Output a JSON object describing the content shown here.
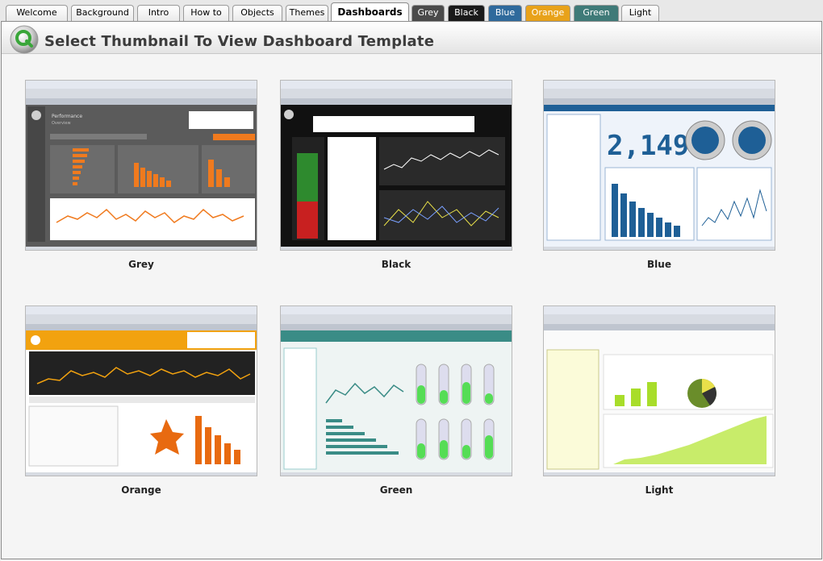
{
  "tabs": [
    {
      "label": "Welcome",
      "style": "light"
    },
    {
      "label": "Background",
      "style": "light"
    },
    {
      "label": "Intro",
      "style": "light"
    },
    {
      "label": "How to",
      "style": "light"
    },
    {
      "label": "Objects",
      "style": "light"
    },
    {
      "label": "Themes",
      "style": "light"
    },
    {
      "label": "Dashboards",
      "style": "active"
    },
    {
      "label": "Grey",
      "style": "grey",
      "color": "#4a4a4a"
    },
    {
      "label": "Black",
      "style": "dark",
      "color": "#1a1a1a"
    },
    {
      "label": "Blue",
      "style": "colored",
      "color": "#2f6a9c"
    },
    {
      "label": "Orange",
      "style": "colored",
      "color": "#e8a21a"
    },
    {
      "label": "Green",
      "style": "colored",
      "color": "#3f7a78"
    },
    {
      "label": "Light",
      "style": "light"
    }
  ],
  "page": {
    "title": "Select Thumbnail To View Dashboard Template"
  },
  "thumbnails": [
    {
      "label": "Grey",
      "theme": "grey",
      "accent": "#f07a1e"
    },
    {
      "label": "Black",
      "theme": "black",
      "accent": "#2e8a2e"
    },
    {
      "label": "Blue",
      "theme": "blue",
      "accent": "#1e5f96"
    },
    {
      "label": "Orange",
      "theme": "orange",
      "accent": "#f2a20f"
    },
    {
      "label": "Green",
      "theme": "green",
      "accent": "#3a8c86"
    },
    {
      "label": "Light",
      "theme": "light",
      "accent": "#a8dd2a"
    }
  ],
  "colors": {
    "frame_bg": "#f5f5f5",
    "title_text": "#3c3c3c",
    "logo_green": "#3aa63a"
  }
}
